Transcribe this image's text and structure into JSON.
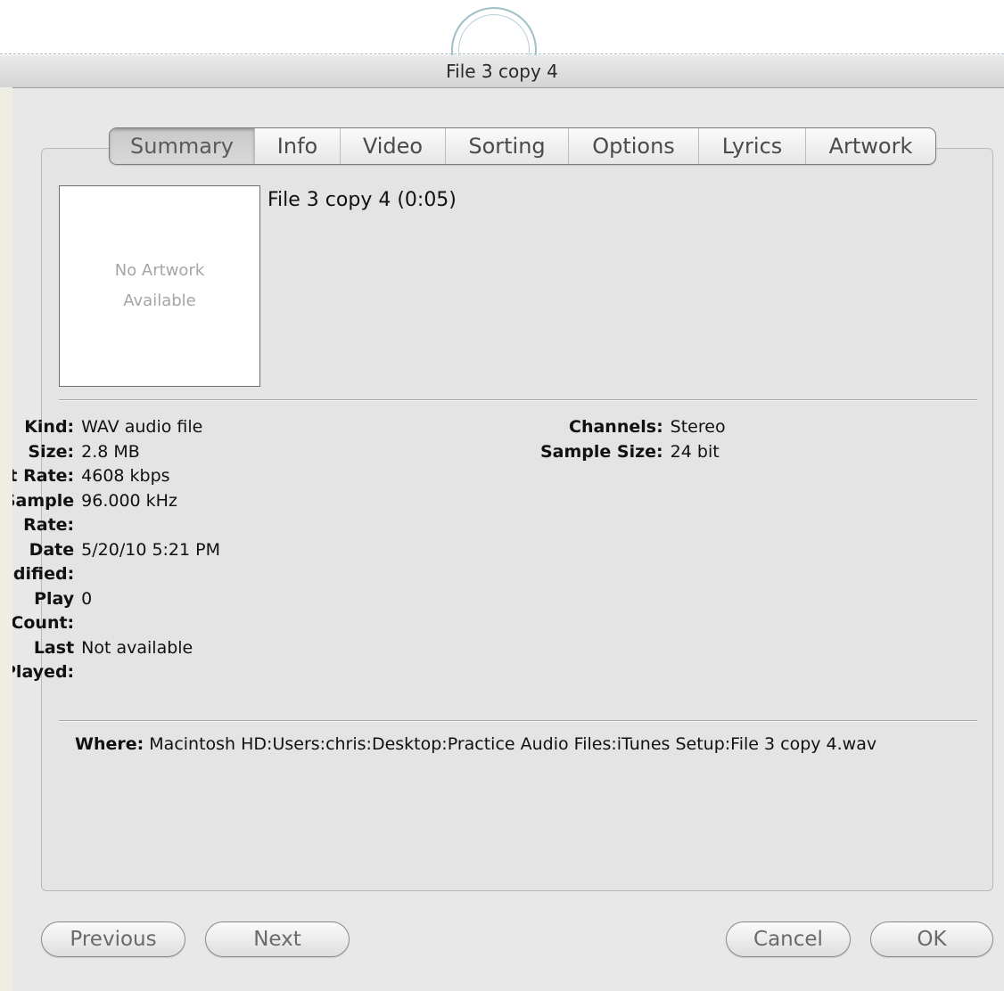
{
  "window": {
    "title": "File 3 copy 4"
  },
  "tabs": [
    {
      "label": "Summary",
      "selected": true
    },
    {
      "label": "Info",
      "selected": false
    },
    {
      "label": "Video",
      "selected": false
    },
    {
      "label": "Sorting",
      "selected": false
    },
    {
      "label": "Options",
      "selected": false
    },
    {
      "label": "Lyrics",
      "selected": false
    },
    {
      "label": "Artwork",
      "selected": false
    }
  ],
  "summary": {
    "artwork_placeholder": "No Artwork\nAvailable",
    "track_title": "File 3 copy 4 (0:05)",
    "left_info": [
      {
        "label": "Kind:",
        "value": "WAV audio file"
      },
      {
        "label": "Size:",
        "value": "2.8 MB"
      },
      {
        "label": "Bit Rate:",
        "value": "4608 kbps"
      },
      {
        "label": "Sample Rate:",
        "value": "96.000 kHz"
      },
      {
        "label": "Date Modified:",
        "value": "5/20/10 5:21 PM"
      },
      {
        "label": "Play Count:",
        "value": "0"
      },
      {
        "label": "Last Played:",
        "value": "Not available"
      }
    ],
    "right_info": [
      {
        "label": "Channels:",
        "value": "Stereo"
      },
      {
        "label": "Sample Size:",
        "value": "24 bit"
      }
    ],
    "where_label": "Where:",
    "where_value": "Macintosh HD:Users:chris:Desktop:Practice Audio Files:iTunes Setup:File 3 copy 4.wav"
  },
  "buttons": {
    "previous": "Previous",
    "next": "Next",
    "cancel": "Cancel",
    "ok": "OK"
  }
}
